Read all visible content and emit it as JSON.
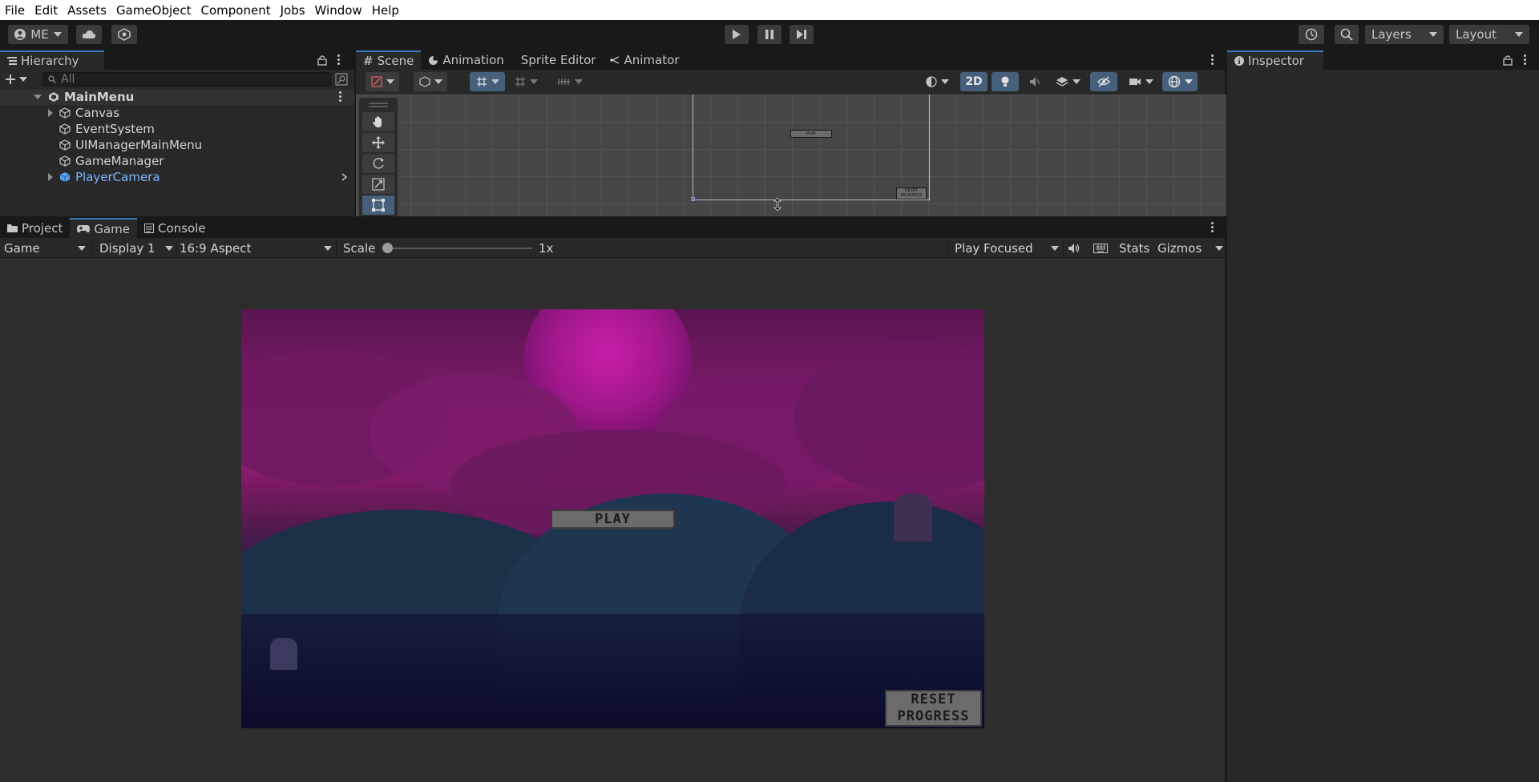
{
  "menu": [
    "File",
    "Edit",
    "Assets",
    "GameObject",
    "Component",
    "Jobs",
    "Window",
    "Help"
  ],
  "toolbar": {
    "account": "ME",
    "layers": "Layers",
    "layout": "Layout"
  },
  "hierarchy": {
    "title": "Hierarchy",
    "search_placeholder": "All",
    "scene": "MainMenu",
    "items": [
      "Canvas",
      "EventSystem",
      "UIManagerMainMenu",
      "GameManager",
      "PlayerCamera"
    ]
  },
  "scene_tabs": [
    "Scene",
    "Animation",
    "Sprite Editor",
    "Animator"
  ],
  "scene_toolbar": {
    "mode_2d": "2D"
  },
  "scene_canvas": {
    "play_label": "PLAY",
    "reset_label": "RESET PROGRESS"
  },
  "bottom_tabs": [
    "Project",
    "Game",
    "Console"
  ],
  "game_toolbar": {
    "mode": "Game",
    "display": "Display 1",
    "aspect": "16:9 Aspect",
    "scale_label": "Scale",
    "scale_value": "1x",
    "play_focus": "Play Focused",
    "stats": "Stats",
    "gizmos": "Gizmos"
  },
  "game": {
    "play_button": "PLAY",
    "reset_line1": "RESET",
    "reset_line2": "PROGRESS"
  },
  "inspector": {
    "title": "Inspector"
  },
  "colors": {
    "accent": "#3a79bb",
    "hierarchy_prefab": "#7bb3ff",
    "mode_2d_bg": "#46607c"
  }
}
